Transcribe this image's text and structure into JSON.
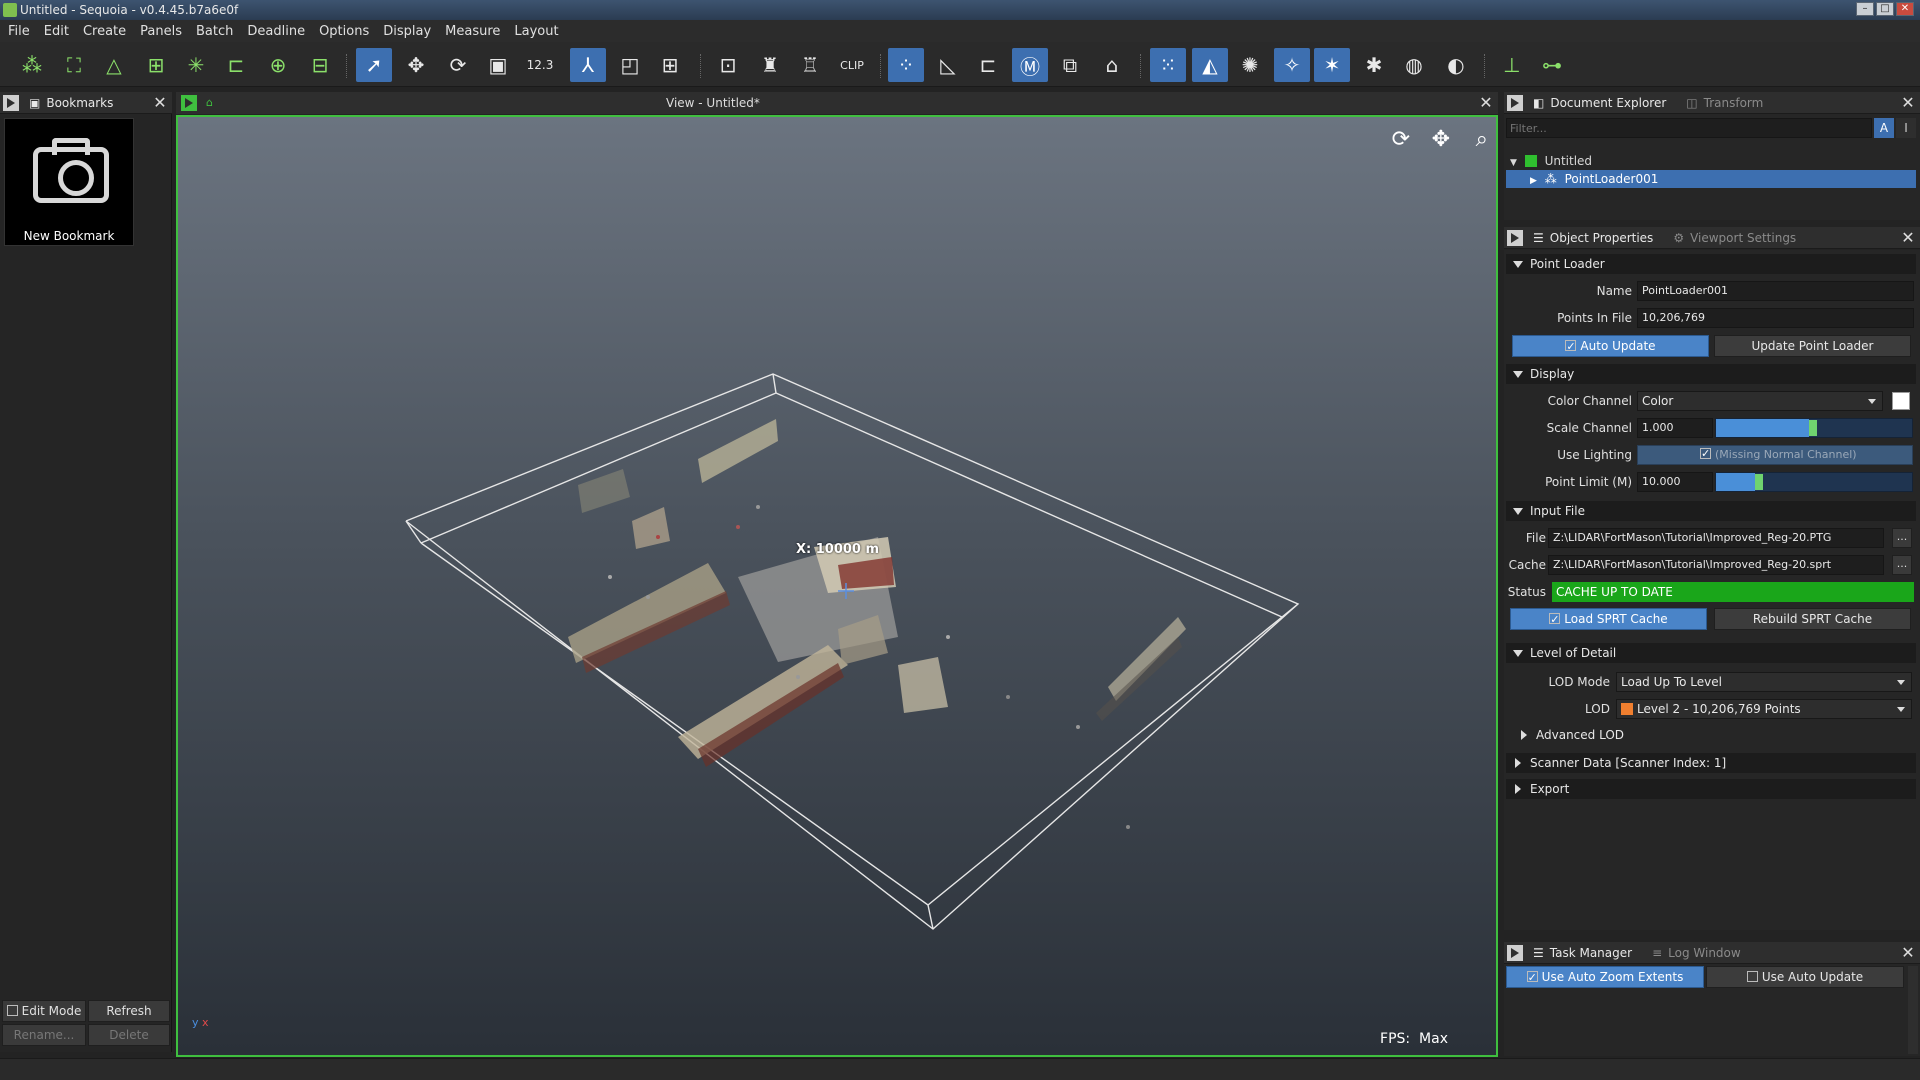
{
  "window": {
    "title": "Untitled - Sequoia - v0.4.45.b7a6e0f"
  },
  "menu": [
    "File",
    "Edit",
    "Create",
    "Panels",
    "Batch",
    "Deadline",
    "Options",
    "Display",
    "Measure",
    "Layout"
  ],
  "toolbar": {
    "measure_label": "12.3",
    "clip_label": "CLIP"
  },
  "bookmarks": {
    "tab": "Bookmarks",
    "item_label": "New Bookmark",
    "edit_mode": "Edit Mode",
    "refresh": "Refresh",
    "rename": "Rename...",
    "delete": "Delete"
  },
  "viewport": {
    "title": "View - Untitled*",
    "fps_label": "FPS:",
    "fps_value": "Max",
    "measure_overlay": "X: 10000 m",
    "axis_x": "x",
    "axis_y": "y"
  },
  "document_explorer": {
    "tab_active": "Document Explorer",
    "tab_inactive": "Transform",
    "filter_placeholder": "Filter...",
    "tree": [
      {
        "label": "Untitled",
        "color": "#2fbf2f"
      },
      {
        "label": "PointLoader001",
        "selected": true
      }
    ]
  },
  "object_properties": {
    "tab_active": "Object Properties",
    "tab_inactive": "Viewport Settings",
    "point_loader": {
      "section": "Point Loader",
      "name_label": "Name",
      "name_value": "PointLoader001",
      "points_label": "Points In File",
      "points_value": "10,206,769",
      "auto_update": "Auto Update",
      "update_button": "Update Point Loader"
    },
    "display": {
      "section": "Display",
      "color_channel_label": "Color Channel",
      "color_channel_value": "Color",
      "scale_channel_label": "Scale Channel",
      "scale_channel_value": "1.000",
      "scale_fraction": 0.48,
      "use_lighting_label": "Use Lighting",
      "use_lighting_value": "(Missing Normal Channel)",
      "point_limit_label": "Point Limit (M)",
      "point_limit_value": "10.000",
      "point_limit_fraction": 0.2
    },
    "input_file": {
      "section": "Input File",
      "file_label": "File",
      "file_value": "Z:\\LIDAR\\FortMason\\Tutorial\\Improved_Reg-20.PTG",
      "cache_label": "Cache",
      "cache_value": "Z:\\LIDAR\\FortMason\\Tutorial\\Improved_Reg-20.sprt",
      "status_label": "Status",
      "status_value": "CACHE UP TO DATE",
      "browse": "...",
      "load_cache": "Load SPRT Cache",
      "rebuild_cache": "Rebuild SPRT Cache"
    },
    "lod": {
      "section": "Level of Detail",
      "mode_label": "LOD Mode",
      "mode_value": "Load Up To Level",
      "lod_label": "LOD",
      "lod_value": "Level 2 - 10,206,769 Points",
      "lod_color": "#f07f2f",
      "advanced": "Advanced LOD"
    },
    "scanner_data": "Scanner Data   [Scanner Index: 1]",
    "export": "Export"
  },
  "task_manager": {
    "tab_active": "Task Manager",
    "tab_inactive": "Log Window",
    "auto_zoom": "Use Auto Zoom Extents",
    "auto_update": "Use Auto Update"
  },
  "colors": {
    "accent_green": "#3fbf3f",
    "accent_blue": "#4a84c8",
    "status_green": "#1aa61a"
  }
}
